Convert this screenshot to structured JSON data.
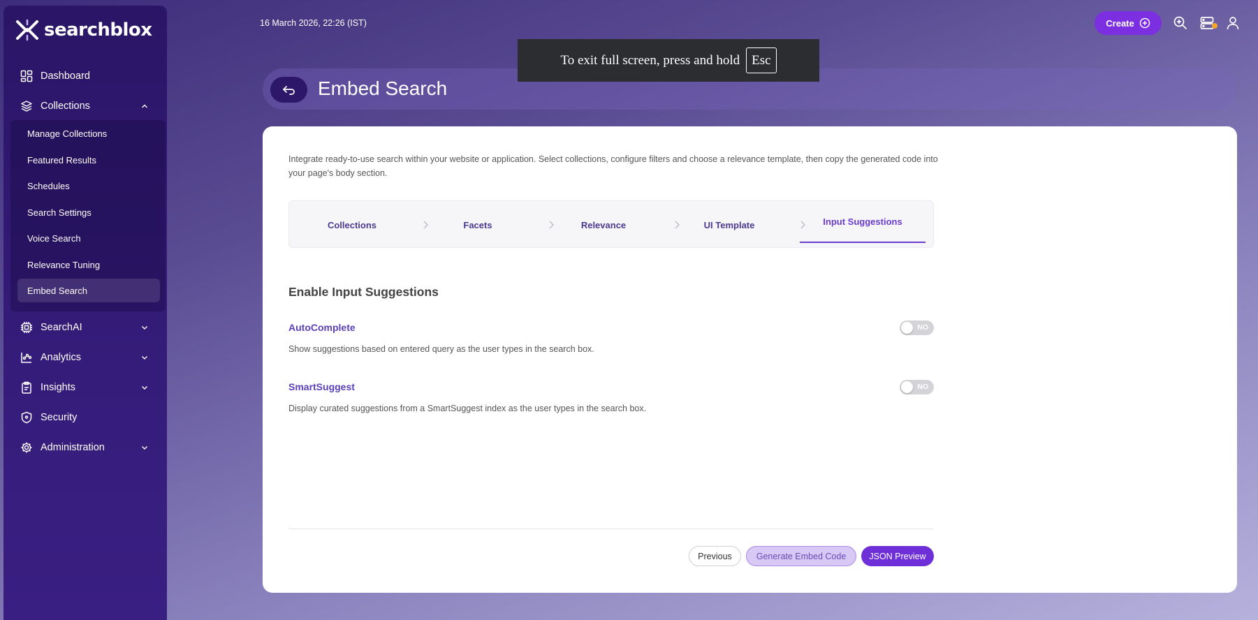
{
  "app": {
    "logo_text": "searchblox"
  },
  "topbar": {
    "datetime": "16 March 2026, 22:26 (IST)",
    "create_label": "Create"
  },
  "fullscreen_toast": {
    "text": "To exit full screen, press and hold",
    "key": "Esc"
  },
  "sidebar": {
    "items": [
      {
        "label": "Dashboard",
        "icon": "dashboard-icon"
      },
      {
        "label": "Collections",
        "icon": "layers-icon",
        "expanded": true
      },
      {
        "label": "SearchAI",
        "icon": "chip-icon"
      },
      {
        "label": "Analytics",
        "icon": "analytics-icon"
      },
      {
        "label": "Insights",
        "icon": "clipboard-icon"
      },
      {
        "label": "Security",
        "icon": "shield-icon"
      },
      {
        "label": "Administration",
        "icon": "gear-icon"
      }
    ],
    "collections_sub": [
      "Manage Collections",
      "Featured Results",
      "Schedules",
      "Search Settings",
      "Voice Search",
      "Relevance Tuning",
      "Embed Search"
    ],
    "active_sub": "Embed Search"
  },
  "page": {
    "title": "Embed Search",
    "intro": "Integrate ready-to-use search within your website or application. Select collections, configure filters and choose a relevance template, then copy the generated code into your page's body section.",
    "steps": [
      "Collections",
      "Facets",
      "Relevance",
      "UI Template",
      "Input Suggestions"
    ],
    "active_step": "Input Suggestions",
    "section_title": "Enable Input Suggestions",
    "options": [
      {
        "label": "AutoComplete",
        "description": "Show suggestions based on entered query as the user types in the search box.",
        "toggle": "NO"
      },
      {
        "label": "SmartSuggest",
        "description": "Display curated suggestions from a SmartSuggest index as the user types in the search box.",
        "toggle": "NO"
      }
    ],
    "buttons": {
      "previous": "Previous",
      "generate": "Generate Embed Code",
      "json_preview": "JSON Preview"
    }
  },
  "colors": {
    "accent": "#6e2fd8",
    "sidebar": "#2a1566",
    "link": "#5a3fb8"
  }
}
